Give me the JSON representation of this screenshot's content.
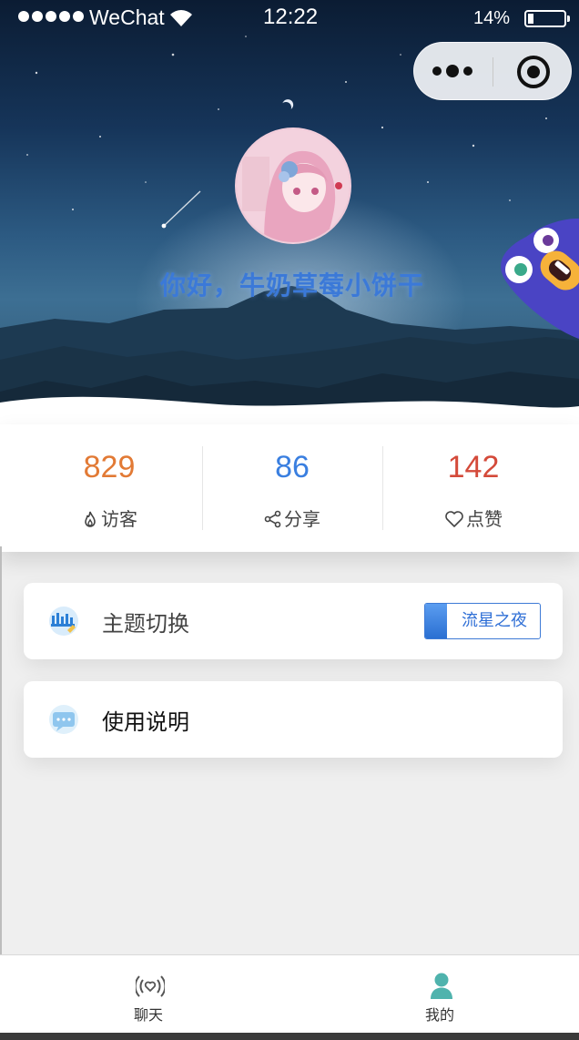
{
  "status_bar": {
    "carrier": "WeChat",
    "time": "12:22",
    "battery_percent": "14%",
    "battery_level": 0.14,
    "signal_dots": 5,
    "icons": [
      "signal-dots-icon",
      "wifi-icon",
      "battery-icon"
    ]
  },
  "capsule": {
    "icons": [
      "more-dots-icon",
      "close-target-icon"
    ]
  },
  "profile": {
    "greeting": "你好，牛奶草莓小饼干"
  },
  "stats": [
    {
      "value": "829",
      "label": "访客",
      "icon": "fire-icon",
      "color": "#e27a35"
    },
    {
      "value": "86",
      "label": "分享",
      "icon": "share-icon",
      "color": "#3a7fe0"
    },
    {
      "value": "142",
      "label": "点赞",
      "icon": "heart-icon",
      "color": "#d44a3a"
    }
  ],
  "menu": {
    "theme": {
      "label": "主题切换",
      "value": "流星之夜",
      "icon": "theme-skyline-icon"
    },
    "help": {
      "label": "使用说明",
      "icon": "chat-bubble-icon"
    }
  },
  "tabbar": {
    "items": [
      {
        "label": "聊天",
        "icon": "radar-heart-icon",
        "active": false
      },
      {
        "label": "我的",
        "icon": "user-icon",
        "active": true
      }
    ]
  },
  "colors": {
    "accent_blue": "#3a7fe0",
    "tab_active": "#4fb3ad",
    "visitor_orange": "#e27a35",
    "like_red": "#d44a3a"
  }
}
